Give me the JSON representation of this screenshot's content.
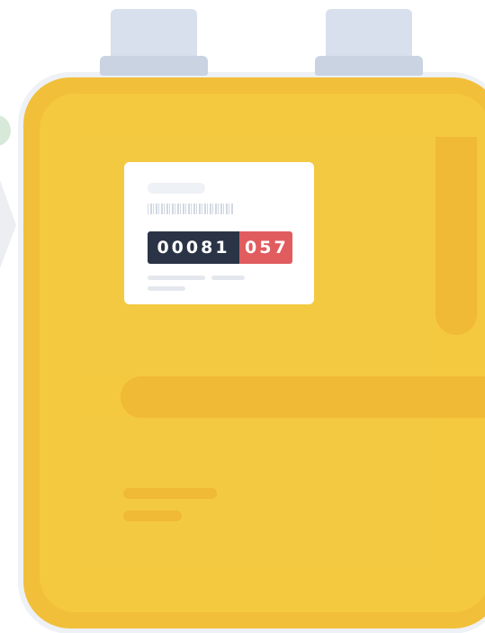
{
  "meter": {
    "reading_whole": "00081",
    "reading_fraction": "057",
    "colors": {
      "body": "#f2bf3a",
      "counter_whole": "#2b3446",
      "counter_fraction": "#e05c5f",
      "connector": "#d7e0ec"
    }
  }
}
